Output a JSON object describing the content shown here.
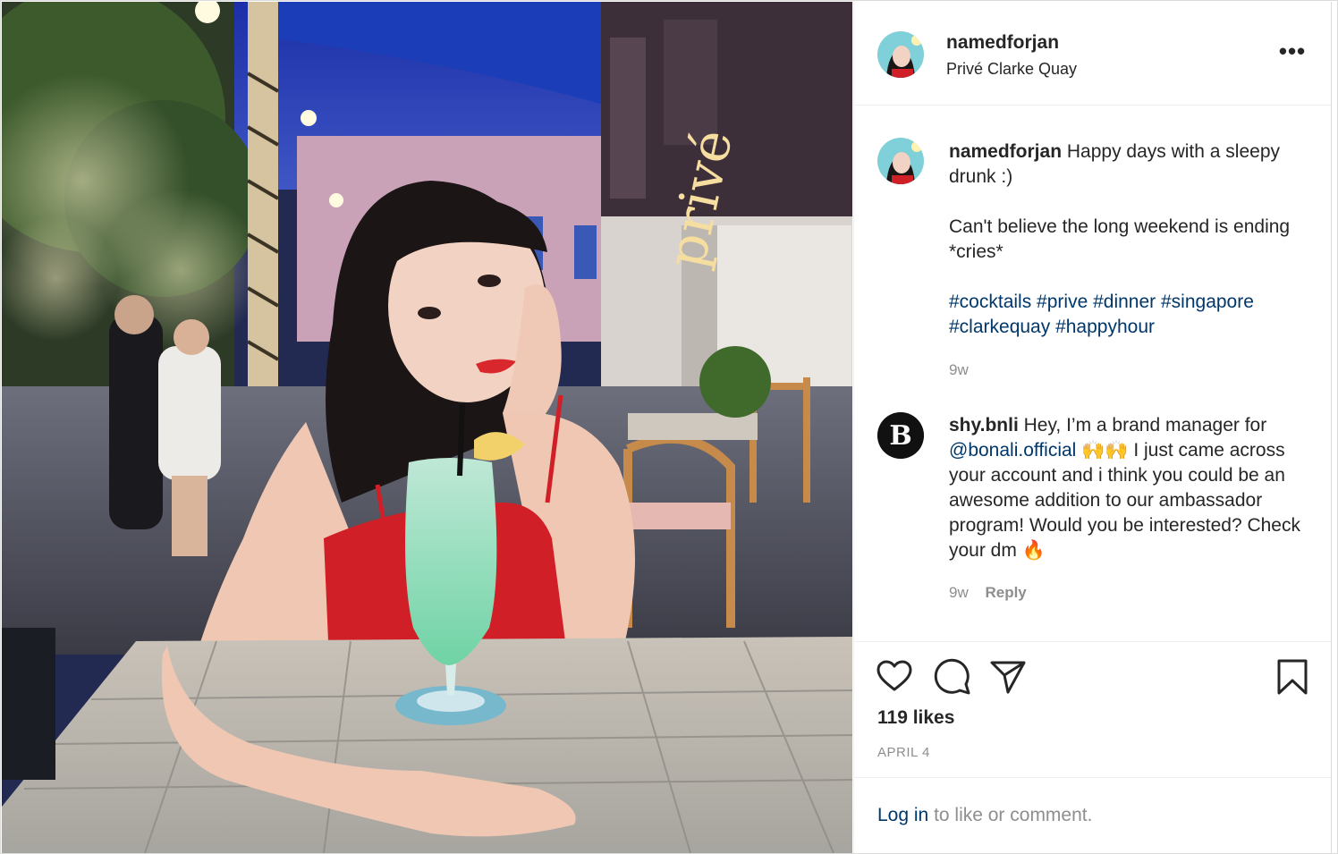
{
  "post": {
    "username": "namedforjan",
    "location": "Privé Clarke Quay",
    "more_label": "•••"
  },
  "caption": {
    "username": "namedforjan",
    "text_line1": "Happy days with a sleepy drunk :)",
    "text_line2": "Can't believe the long weekend is ending *cries*",
    "hashtags": [
      "#cocktails",
      "#prive",
      "#dinner",
      "#singapore",
      "#clarkequay",
      "#happyhour"
    ],
    "age": "9w"
  },
  "comment": {
    "avatar_letter": "B",
    "username": "shy.bnli",
    "text_before": "Hey, I’m a brand manager for",
    "mention": "@bonali.official",
    "emoji": "🙌🙌",
    "text_after": "I just came across your account and i think you could be an awesome addition to our ambassador program! Would you be interested? Check your dm",
    "fire_emoji": "🔥",
    "age": "9w",
    "reply_label": "Reply"
  },
  "actions": {
    "likes": "119 likes",
    "date": "APRIL 4"
  },
  "login": {
    "link": "Log in",
    "rest": "to like or comment."
  },
  "photo": {
    "sign_text": "privé"
  },
  "colors": {
    "link": "#00376b",
    "muted": "#8e8e8e",
    "text": "#262626"
  }
}
